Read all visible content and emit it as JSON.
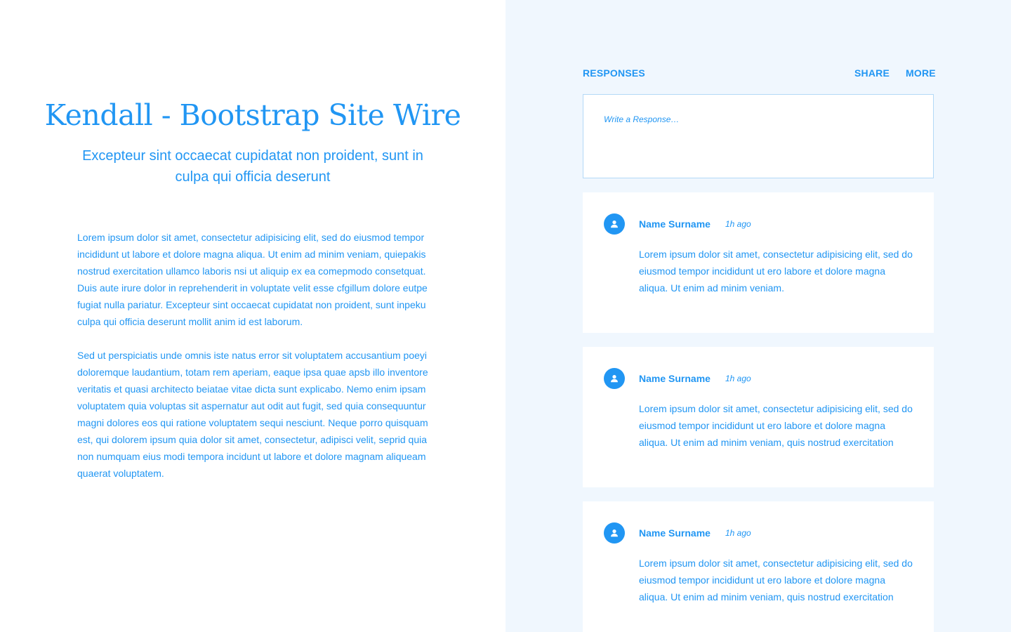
{
  "article": {
    "title": "Kendall - Bootstrap Site Wire",
    "subtitle": "Excepteur sint occaecat cupidatat non proident, sunt in culpa qui officia deserunt",
    "paragraphs": [
      "Lorem ipsum dolor sit amet, consectetur adipisicing elit, sed do eiusmod tempor incididunt ut labore et dolore magna aliqua. Ut enim ad minim veniam, quiepakis nostrud exercitation ullamco laboris nsi ut aliquip ex ea comepmodo consetquat. Duis aute irure dolor in reprehenderit in voluptate velit esse cfgillum dolore eutpe fugiat nulla pariatur. Excepteur sint occaecat cupidatat non proident, sunt inpeku culpa qui officia deserunt mollit anim id est laborum.",
      "Sed ut perspiciatis unde omnis iste natus error sit voluptatem accusantium poeyi doloremque laudantium, totam rem aperiam, eaque ipsa quae apsb illo inventore veritatis et quasi architecto beiatae vitae dicta sunt explicabo. Nemo enim ipsam voluptatem quia voluptas sit aspernatur aut odit aut fugit, sed quia consequuntur magni dolores eos qui ratione voluptatem sequi nesciunt. Neque porro quisquam est, qui dolorem ipsum quia dolor sit amet, consectetur, adipisci velit, seprid quia non numquam eius modi tempora incidunt ut labore et dolore magnam aliqueam quaerat voluptatem."
    ]
  },
  "responses": {
    "label": "RESPONSES",
    "share_label": "SHARE",
    "more_label": "MORE",
    "input_placeholder": "Write a Response…",
    "comments": [
      {
        "author": "Name Surname",
        "time": "1h ago",
        "text": "Lorem ipsum dolor sit amet, consectetur adipisicing elit, sed do eiusmod tempor incididunt ut ero labore et dolore magna aliqua. Ut enim ad minim veniam."
      },
      {
        "author": "Name Surname",
        "time": "1h ago",
        "text": "Lorem ipsum dolor sit amet, consectetur adipisicing elit, sed do eiusmod tempor incididunt ut ero labore et dolore magna aliqua. Ut enim ad minim veniam, quis nostrud exercitation"
      },
      {
        "author": "Name Surname",
        "time": "1h ago",
        "text": "Lorem ipsum dolor sit amet, consectetur adipisicing elit, sed do eiusmod tempor incididunt ut ero labore et dolore magna aliqua. Ut enim ad minim veniam, quis nostrud exercitation"
      }
    ]
  },
  "colors": {
    "accent": "#2196f3",
    "right_background": "#f0f7fe",
    "card_background": "#ffffff",
    "input_border": "#b3d9f7"
  },
  "icons": {
    "avatar": "user-icon"
  }
}
